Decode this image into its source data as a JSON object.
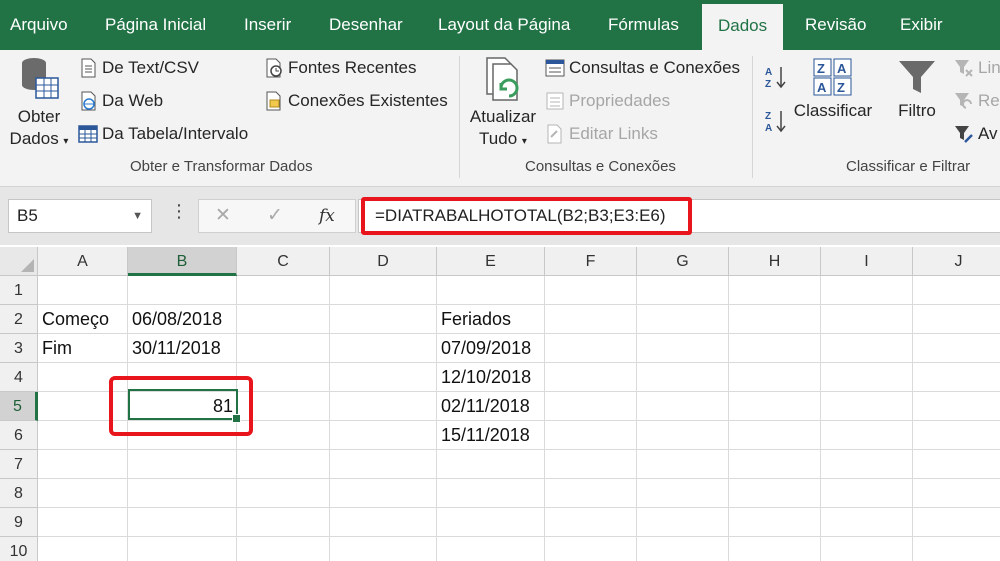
{
  "tabs": [
    "Arquivo",
    "Página Inicial",
    "Inserir",
    "Desenhar",
    "Layout da Página",
    "Fórmulas",
    "Dados",
    "Revisão",
    "Exibir"
  ],
  "active_tab": "Dados",
  "ribbon": {
    "get_data": {
      "big_button_line1": "Obter",
      "big_button_line2": "Dados",
      "from_text": "De Text/CSV",
      "from_web": "Da Web",
      "from_table": "Da Tabela/Intervalo",
      "recent_sources": "Fontes Recentes",
      "existing_connections": "Conexões Existentes",
      "group_label": "Obter e Transformar Dados"
    },
    "queries": {
      "refresh_line1": "Atualizar",
      "refresh_line2": "Tudo",
      "queries_connections": "Consultas e Conexões",
      "properties": "Propriedades",
      "edit_links": "Editar Links",
      "group_label": "Consultas e Conexões"
    },
    "sort_filter": {
      "sort": "Classificar",
      "filter": "Filtro",
      "clear_partial": "Lin",
      "reapply_partial": "Re",
      "advanced_partial": "Av",
      "group_label": "Classificar e Filtrar"
    }
  },
  "formula_bar": {
    "name_box": "B5",
    "formula": "=DIATRABALHOTOTAL(B2;B3;E3:E6)"
  },
  "grid": {
    "columns": [
      "A",
      "B",
      "C",
      "D",
      "E",
      "F",
      "G",
      "H",
      "I",
      "J"
    ],
    "rows": [
      "1",
      "2",
      "3",
      "4",
      "5",
      "6",
      "7",
      "8",
      "9",
      "10"
    ],
    "cells": {
      "A2": "Começo",
      "B2": "06/08/2018",
      "A3": "Fim",
      "B3": "30/11/2018",
      "B5": "81",
      "E2": "Feriados",
      "E3": "07/09/2018",
      "E4": "12/10/2018",
      "E5": "02/11/2018",
      "E6": "15/11/2018"
    }
  },
  "colors": {
    "accent": "#217346",
    "highlight_box": "#e8161c"
  }
}
